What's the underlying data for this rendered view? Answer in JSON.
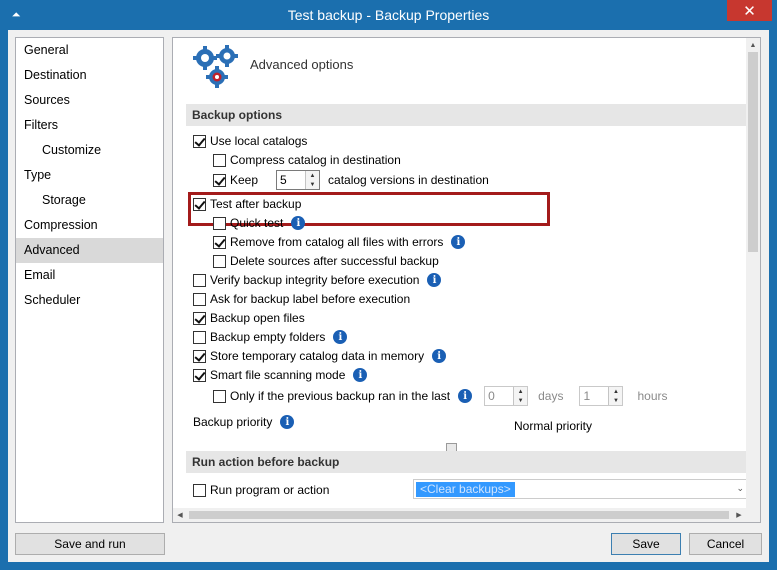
{
  "window": {
    "title": "Test backup - Backup Properties",
    "close_glyph": "✕",
    "sysmenu_glyph": "⏶"
  },
  "nav": {
    "items": [
      {
        "label": "General",
        "sub": false
      },
      {
        "label": "Destination",
        "sub": false
      },
      {
        "label": "Sources",
        "sub": false
      },
      {
        "label": "Filters",
        "sub": false
      },
      {
        "label": "Customize",
        "sub": true
      },
      {
        "label": "Type",
        "sub": false
      },
      {
        "label": "Storage",
        "sub": true
      },
      {
        "label": "Compression",
        "sub": false
      },
      {
        "label": "Advanced",
        "sub": false,
        "selected": true
      },
      {
        "label": "Email",
        "sub": false
      },
      {
        "label": "Scheduler",
        "sub": false
      }
    ]
  },
  "header": {
    "title": "Advanced options",
    "icon": "gears-icon"
  },
  "backup_options": {
    "section_title": "Backup options",
    "use_local_catalogs": {
      "label": "Use local catalogs",
      "checked": true
    },
    "compress_catalog": {
      "label": "Compress catalog in destination",
      "checked": false
    },
    "keep": {
      "label": "Keep",
      "checked": true,
      "value": "5",
      "suffix": "catalog versions in destination"
    },
    "test_after_backup": {
      "label": "Test after backup",
      "checked": true
    },
    "quick_test": {
      "label": "Quick test",
      "checked": false
    },
    "remove_from_catalog": {
      "label": "Remove from catalog all files with errors",
      "checked": true
    },
    "delete_sources": {
      "label": "Delete sources after successful backup",
      "checked": false
    },
    "verify_integrity": {
      "label": "Verify backup integrity before execution",
      "checked": false
    },
    "ask_label": {
      "label": "Ask for backup label before execution",
      "checked": false
    },
    "open_files": {
      "label": "Backup open files",
      "checked": true
    },
    "empty_folders": {
      "label": "Backup empty folders",
      "checked": false
    },
    "store_temp": {
      "label": "Store temporary catalog data in memory",
      "checked": true
    },
    "smart_scan": {
      "label": "Smart file scanning mode",
      "checked": true
    },
    "only_if_previous": {
      "label": "Only if the previous backup ran in the last",
      "checked": false,
      "days_value": "0",
      "days_label": "days",
      "hours_value": "1",
      "hours_label": "hours"
    },
    "priority": {
      "label": "Backup priority",
      "value_label": "Normal priority",
      "level": 0.5
    }
  },
  "run_action": {
    "section_title": "Run action before backup",
    "run_program": {
      "label": "Run program or action",
      "checked": false
    },
    "selected_action": "<Clear backups>"
  },
  "buttons": {
    "save_and_run": "Save and run",
    "save": "Save",
    "cancel": "Cancel"
  },
  "colors": {
    "titlebar": "#1b6fae",
    "close": "#c7372f",
    "highlight_border": "#a31b1b",
    "info_icon": "#1a5fb4",
    "selection": "#3399ff"
  }
}
